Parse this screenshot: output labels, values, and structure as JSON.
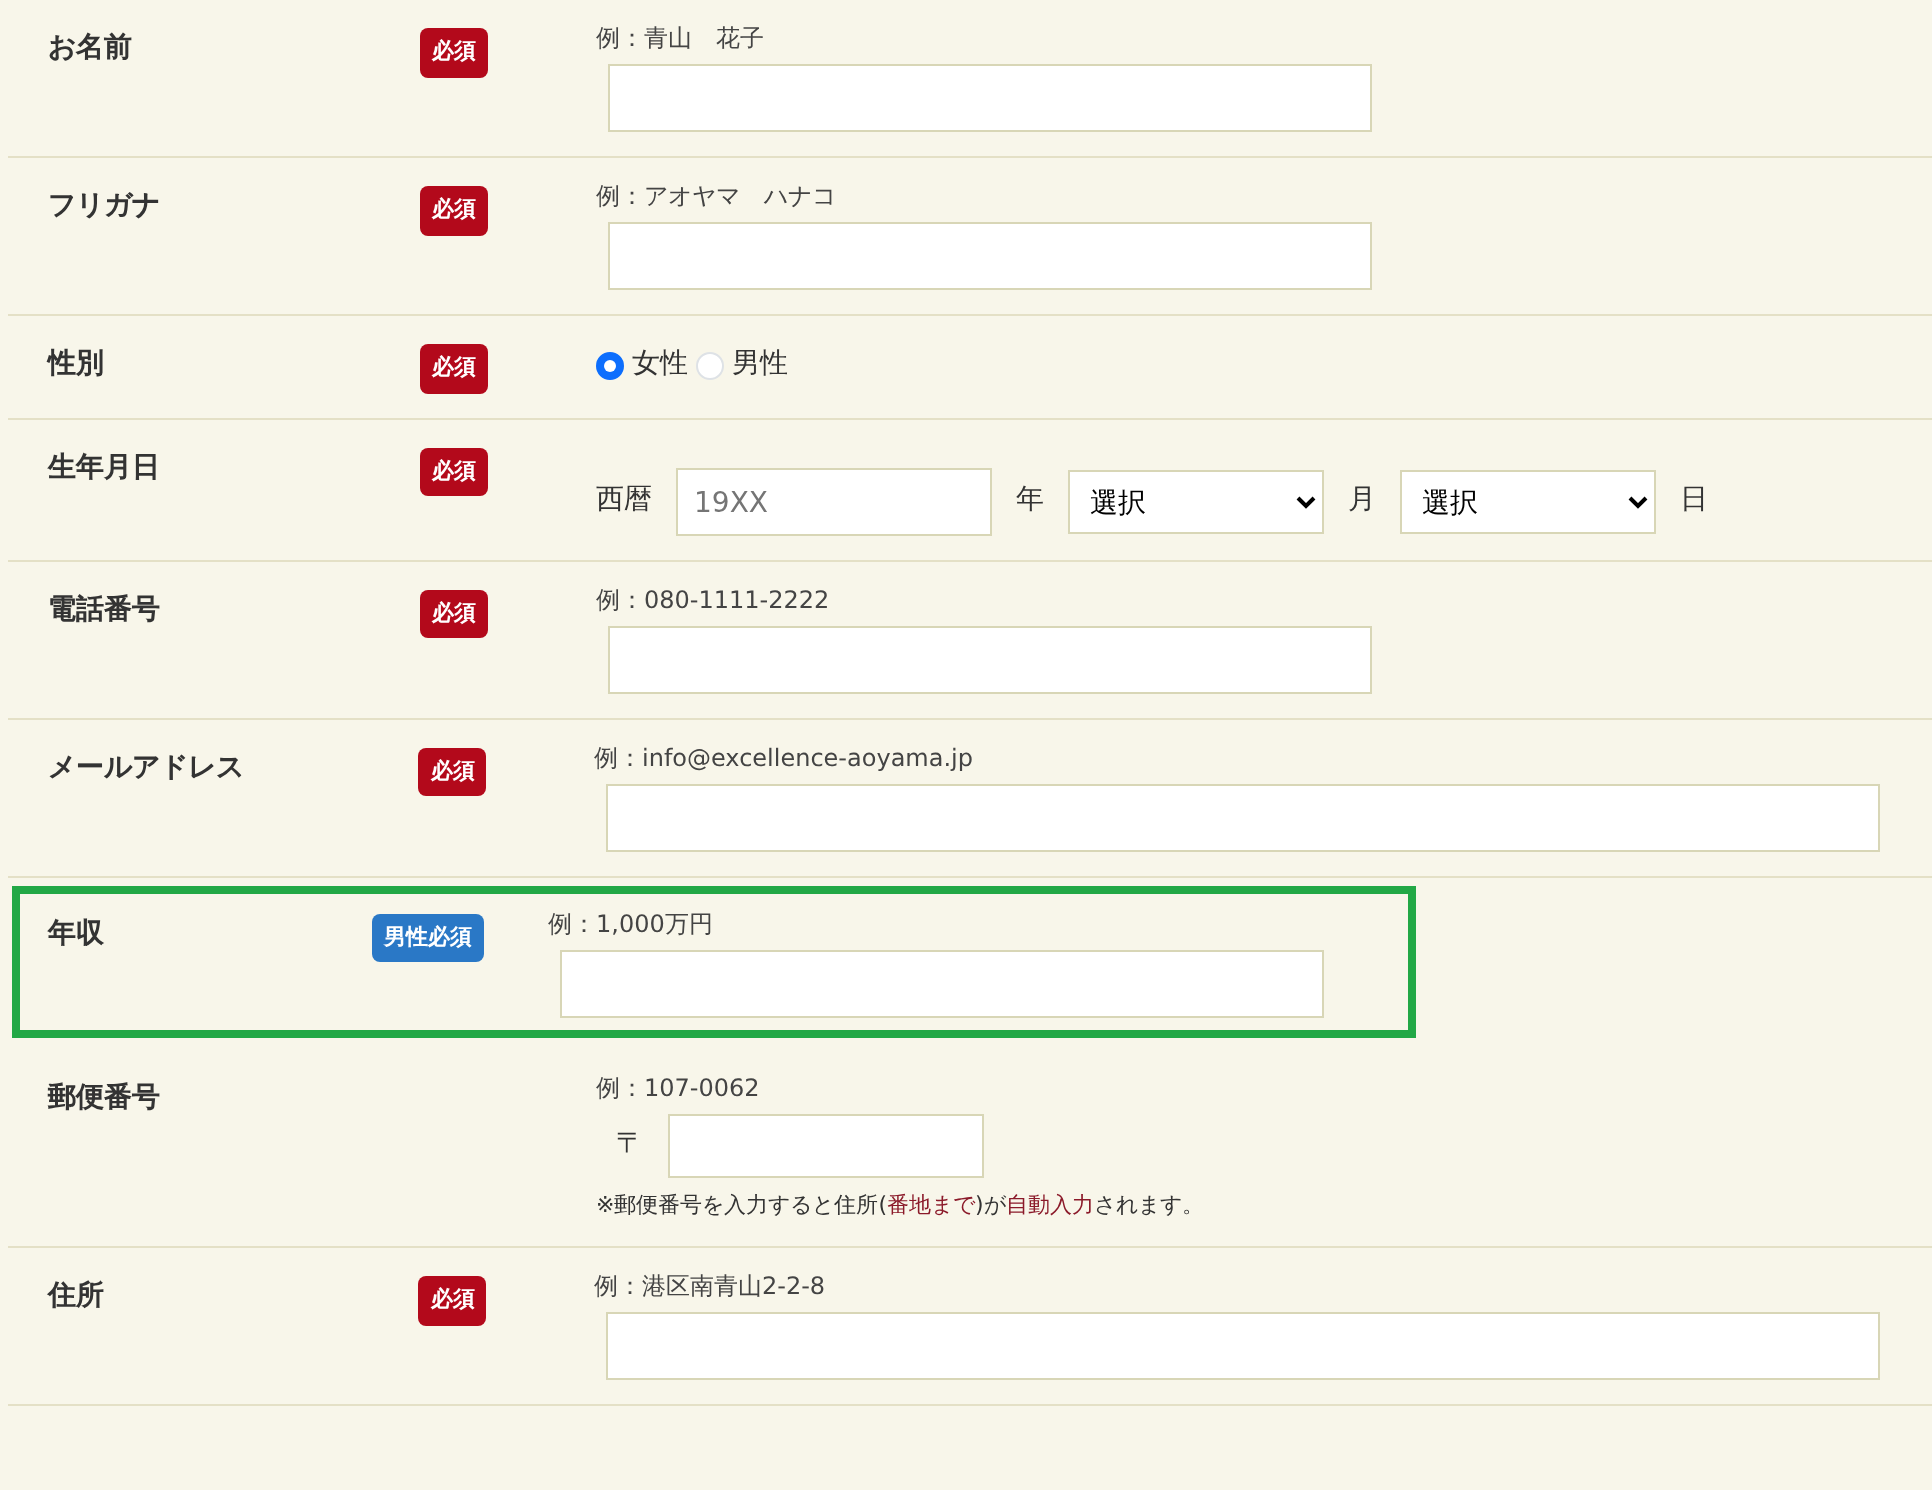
{
  "rows": [
    {
      "kind": "text",
      "label": "お名前",
      "badge": {
        "text": "必須",
        "kind": "required"
      },
      "example": "例：青山　花子",
      "wide": false,
      "highlighted": false
    },
    {
      "kind": "text",
      "label": "フリガナ",
      "badge": {
        "text": "必須",
        "kind": "required"
      },
      "example": "例：アオヤマ　ハナコ",
      "wide": false,
      "highlighted": false
    },
    {
      "kind": "radio",
      "label": "性別",
      "badge": {
        "text": "必須",
        "kind": "required"
      },
      "options": [
        {
          "label": "女性",
          "selected": true
        },
        {
          "label": "男性",
          "selected": false
        }
      ],
      "highlighted": false
    },
    {
      "kind": "birth",
      "label": "生年月日",
      "badge": {
        "text": "必須",
        "kind": "required"
      },
      "parts": [
        {
          "kind": "unit",
          "text": "西暦"
        },
        {
          "kind": "input",
          "placeholder": "19XX"
        },
        {
          "kind": "unit",
          "text": "年"
        },
        {
          "kind": "select",
          "value": "選択"
        },
        {
          "kind": "unit",
          "text": "月"
        },
        {
          "kind": "select",
          "value": "選択"
        },
        {
          "kind": "unit",
          "text": "日"
        }
      ],
      "highlighted": false
    },
    {
      "kind": "text",
      "label": "電話番号",
      "badge": {
        "text": "必須",
        "kind": "required"
      },
      "example": "例：080-1111-2222",
      "wide": false,
      "highlighted": false
    },
    {
      "kind": "text",
      "label": "メールアドレス",
      "badge": {
        "text": "必須",
        "kind": "required"
      },
      "example": "例：info@excellence-aoyama.jp",
      "wide": true,
      "highlighted": false
    },
    {
      "kind": "text",
      "label": "年収",
      "badge": {
        "text": "男性必須",
        "kind": "male"
      },
      "example": "例：1,000万円",
      "wide": false,
      "highlighted": true
    },
    {
      "kind": "postal",
      "label": "郵便番号",
      "example": "例：107-0062",
      "prefix": "〒",
      "note": [
        {
          "text": "※郵便番号を入力すると住所(",
          "emphasis": false
        },
        {
          "text": "番地まで",
          "emphasis": true
        },
        {
          "text": ")が",
          "emphasis": false
        },
        {
          "text": "自動入力",
          "emphasis": true
        },
        {
          "text": "されます。",
          "emphasis": false
        }
      ],
      "highlighted": false
    },
    {
      "kind": "text",
      "label": "住所",
      "badge": {
        "text": "必須",
        "kind": "required"
      },
      "example": "例：港区南青山2-2-8",
      "wide": true,
      "highlighted": false
    }
  ]
}
